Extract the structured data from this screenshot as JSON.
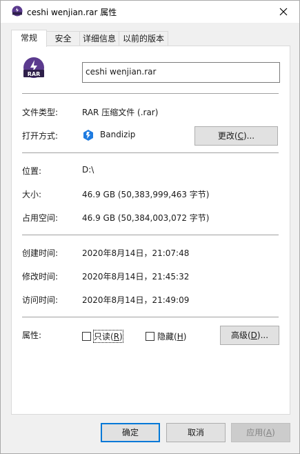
{
  "window": {
    "title": "ceshi wenjian.rar 属性"
  },
  "tabs": [
    {
      "label": "常规"
    },
    {
      "label": "安全"
    },
    {
      "label": "详细信息"
    },
    {
      "label": "以前的版本"
    }
  ],
  "general": {
    "icon_badge": "RAR",
    "file_name": "ceshi wenjian.rar",
    "file_type_label": "文件类型:",
    "file_type_value": "RAR 压缩文件 (.rar)",
    "open_with_label": "打开方式:",
    "open_with_app": "Bandizip",
    "change_button": {
      "prefix": "更改(",
      "key": "C",
      "suffix": ")..."
    },
    "location_label": "位置:",
    "location_value": "D:\\",
    "size_label": "大小:",
    "size_value": "46.9 GB (50,383,999,463 字节)",
    "size_on_disk_label": "占用空间:",
    "size_on_disk_value": "46.9 GB (50,384,003,072 字节)",
    "created_label": "创建时间:",
    "created_value": "2020年8月14日，21:07:48",
    "modified_label": "修改时间:",
    "modified_value": "2020年8月14日，21:45:32",
    "accessed_label": "访问时间:",
    "accessed_value": "2020年8月14日，21:49:09",
    "attributes_label": "属性:",
    "readonly": {
      "prefix": "只读(",
      "key": "R",
      "suffix": ")"
    },
    "hidden": {
      "prefix": "隐藏(",
      "key": "H",
      "suffix": ")"
    },
    "advanced_button": {
      "prefix": "高级(",
      "key": "D",
      "suffix": ")..."
    }
  },
  "footer": {
    "ok": "确定",
    "cancel": "取消",
    "apply": {
      "prefix": "应用(",
      "key": "A",
      "suffix": ")"
    }
  },
  "colors": {
    "rar_purple": "#5b3a8e",
    "bandizip_blue": "#1e7be0",
    "focus_blue": "#0078d7"
  }
}
